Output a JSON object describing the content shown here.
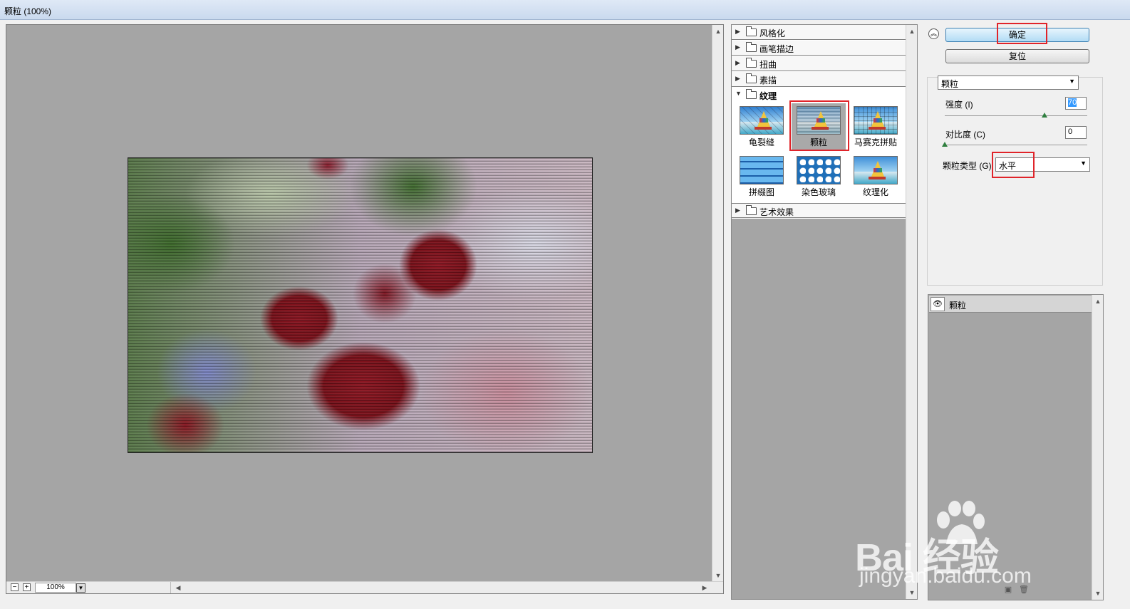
{
  "window": {
    "title": "颗粒 (100%)"
  },
  "preview": {
    "zoom": "100%",
    "zoom_out": "−",
    "zoom_in": "+"
  },
  "gallery": {
    "categories_top": [
      {
        "label": "风格化"
      },
      {
        "label": "画笔描边"
      },
      {
        "label": "扭曲"
      },
      {
        "label": "素描"
      }
    ],
    "open_category": {
      "label": "纹理"
    },
    "thumbnails": [
      {
        "label": "龟裂缝"
      },
      {
        "label": "颗粒"
      },
      {
        "label": "马赛克拼贴"
      },
      {
        "label": "拼缀图"
      },
      {
        "label": "染色玻璃"
      },
      {
        "label": "纹理化"
      }
    ],
    "categories_bottom": [
      {
        "label": "艺术效果"
      }
    ]
  },
  "actions": {
    "ok": "确定",
    "reset": "复位"
  },
  "settings": {
    "filter_select": "颗粒",
    "intensity_label": "强度 (I)",
    "intensity_value": "70",
    "intensity_fraction": 0.7,
    "contrast_label": "对比度 (C)",
    "contrast_value": "0",
    "contrast_fraction": 0.0,
    "grain_type_label": "颗粒类型 (G):",
    "grain_type_value": "水平"
  },
  "layers": {
    "items": [
      {
        "name": "颗粒"
      }
    ]
  },
  "watermark": {
    "brand": "Bai 经验",
    "url": "jingyan.baidu.com"
  },
  "colors": {
    "highlight": "#e0242a",
    "primary_button": "#b2dcf5"
  }
}
